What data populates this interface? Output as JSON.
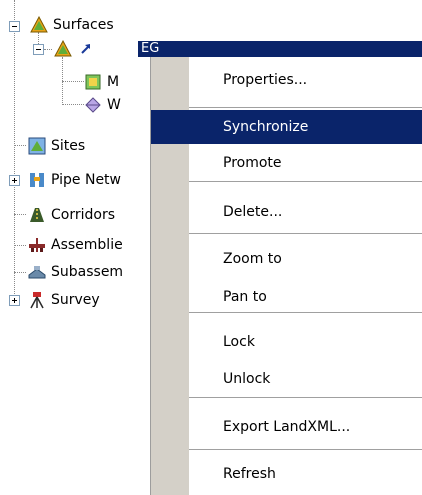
{
  "tree": {
    "surfaces": {
      "label": "Surfaces",
      "icon": "surfaces-icon"
    },
    "eg": {
      "label": "EG",
      "icon": "surface-icon"
    },
    "masks": {
      "label": "M",
      "icon": "masks-icon"
    },
    "watersheds": {
      "label": "W",
      "icon": "watersheds-icon"
    },
    "sites": {
      "label": "Sites",
      "icon": "sites-icon"
    },
    "pipe_networks": {
      "label": "Pipe Netw",
      "icon": "pipe-network-icon"
    },
    "corridors": {
      "label": "Corridors",
      "icon": "corridors-icon"
    },
    "assemblies": {
      "label": "Assemblie",
      "icon": "assemblies-icon"
    },
    "subassemblies": {
      "label": "Subassem",
      "icon": "subassemblies-icon"
    },
    "survey": {
      "label": "Survey",
      "icon": "survey-icon"
    }
  },
  "context_menu": {
    "items": [
      {
        "label": "Properties..."
      },
      {
        "label": "Synchronize"
      },
      {
        "label": "Promote"
      },
      {
        "label": "Delete..."
      },
      {
        "label": "Zoom to"
      },
      {
        "label": "Pan to"
      },
      {
        "label": "Lock"
      },
      {
        "label": "Unlock"
      },
      {
        "label": "Export LandXML..."
      },
      {
        "label": "Refresh"
      }
    ],
    "highlighted": "Synchronize"
  },
  "colors": {
    "selection": "#0a246a",
    "gutter": "#d4d0c8",
    "tree_lines": "#8a8a8a"
  }
}
